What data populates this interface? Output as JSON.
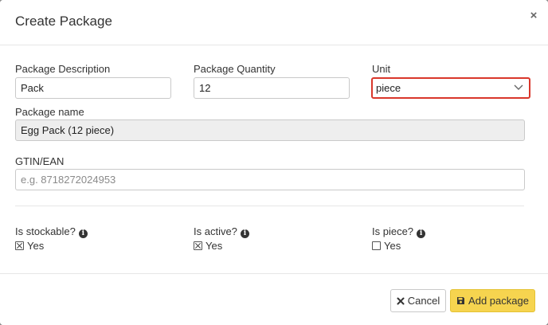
{
  "modal": {
    "title": "Create Package",
    "close_glyph": "×"
  },
  "form": {
    "package_description": {
      "label": "Package Description",
      "value": "Pack"
    },
    "package_quantity": {
      "label": "Package Quantity",
      "value": "12"
    },
    "unit": {
      "label": "Unit",
      "value": "piece"
    },
    "package_name": {
      "label": "Package name",
      "value": "Egg Pack (12 piece)"
    },
    "gtin": {
      "label": "GTIN/EAN",
      "value": "",
      "placeholder": "e.g. 8718272024953"
    },
    "is_stockable": {
      "label": "Is stockable?",
      "option": "Yes",
      "checked": true
    },
    "is_active": {
      "label": "Is active?",
      "option": "Yes",
      "checked": true
    },
    "is_piece": {
      "label": "Is piece?",
      "option": "Yes",
      "checked": false
    },
    "info_glyph": "i"
  },
  "footer": {
    "cancel_label": "Cancel",
    "add_label": "Add package"
  },
  "icons": {
    "close": "close-icon",
    "chevron": "chevron-down-icon",
    "info": "info-icon",
    "cancel": "times-icon",
    "save": "floppy-disk-icon"
  },
  "colors": {
    "highlight_border": "#d9372b",
    "primary_button": "#f6d44f",
    "readonly_bg": "#eeeeee"
  }
}
